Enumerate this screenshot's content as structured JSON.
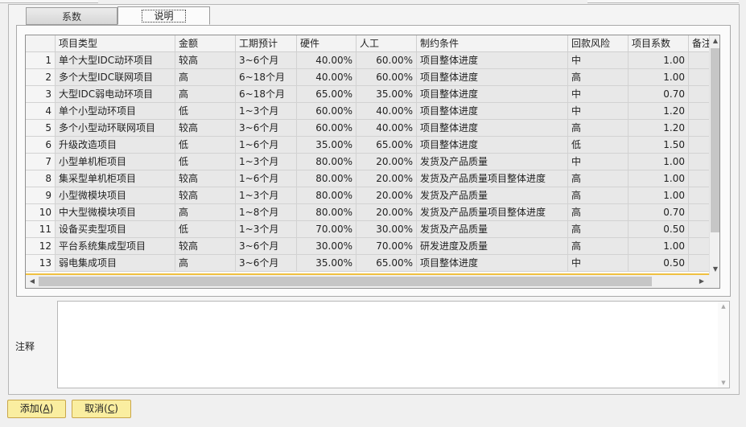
{
  "tabs": [
    {
      "label": "系数"
    },
    {
      "label": "说明"
    }
  ],
  "table": {
    "columns": [
      "",
      "项目类型",
      "金额",
      "工期预计",
      "硬件",
      "人工",
      "制约条件",
      "回款风险",
      "项目系数",
      "备注"
    ],
    "rows": [
      [
        "1",
        "单个大型IDC动环项目",
        "较高",
        "3~6个月",
        "40.00%",
        "60.00%",
        "项目整体进度",
        "中",
        "1.00",
        ""
      ],
      [
        "2",
        "多个大型IDC联网项目",
        "高",
        "6~18个月",
        "40.00%",
        "60.00%",
        "项目整体进度",
        "高",
        "1.00",
        ""
      ],
      [
        "3",
        "大型IDC弱电动环项目",
        "高",
        "6~18个月",
        "65.00%",
        "35.00%",
        "项目整体进度",
        "中",
        "0.70",
        ""
      ],
      [
        "4",
        "单个小型动环项目",
        "低",
        "1~3个月",
        "60.00%",
        "40.00%",
        "项目整体进度",
        "中",
        "1.20",
        ""
      ],
      [
        "5",
        "多个小型动环联网项目",
        "较高",
        "3~6个月",
        "60.00%",
        "40.00%",
        "项目整体进度",
        "高",
        "1.20",
        ""
      ],
      [
        "6",
        "升级改造项目",
        "低",
        "1~6个月",
        "35.00%",
        "65.00%",
        "项目整体进度",
        "低",
        "1.50",
        ""
      ],
      [
        "7",
        "小型单机柜项目",
        "低",
        "1~3个月",
        "80.00%",
        "20.00%",
        "发货及产品质量",
        "中",
        "1.00",
        ""
      ],
      [
        "8",
        "集采型单机柜项目",
        "较高",
        "1~6个月",
        "80.00%",
        "20.00%",
        "发货及产品质量项目整体进度",
        "高",
        "1.00",
        ""
      ],
      [
        "9",
        "小型微模块项目",
        "较高",
        "1~3个月",
        "80.00%",
        "20.00%",
        "发货及产品质量",
        "高",
        "1.00",
        ""
      ],
      [
        "10",
        "中大型微模块项目",
        "高",
        "1~8个月",
        "80.00%",
        "20.00%",
        "发货及产品质量项目整体进度",
        "高",
        "0.70",
        ""
      ],
      [
        "11",
        "设备买卖型项目",
        "低",
        "1~3个月",
        "70.00%",
        "30.00%",
        "发货及产品质量",
        "高",
        "0.50",
        ""
      ],
      [
        "12",
        "平台系统集成型项目",
        "较高",
        "3~6个月",
        "30.00%",
        "70.00%",
        "研发进度及质量",
        "高",
        "1.00",
        ""
      ],
      [
        "13",
        "弱电集成项目",
        "高",
        "3~6个月",
        "35.00%",
        "65.00%",
        "项目整体进度",
        "中",
        "0.50",
        ""
      ]
    ]
  },
  "note": {
    "label": "注释",
    "value": ""
  },
  "buttons": {
    "add": "添加",
    "add_key": "A",
    "cancel": "取消",
    "cancel_key": "C"
  }
}
